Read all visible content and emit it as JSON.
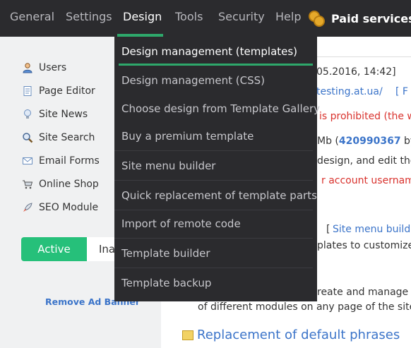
{
  "topnav": {
    "items": [
      "General",
      "Settings",
      "Design",
      "Tools",
      "Security",
      "Help"
    ],
    "active": "Design",
    "paid_label": "Paid services"
  },
  "sidebar": {
    "items": [
      {
        "label": "Users",
        "icon": "user-icon"
      },
      {
        "label": "Page Editor",
        "icon": "page-icon"
      },
      {
        "label": "Site News",
        "icon": "bulb-icon"
      },
      {
        "label": "Site Search",
        "icon": "search-icon"
      },
      {
        "label": "Email Forms",
        "icon": "mail-icon"
      },
      {
        "label": "Online Shop",
        "icon": "cart-icon"
      },
      {
        "label": "SEO Module",
        "icon": "rocket-icon"
      }
    ],
    "toggle_active": "Active",
    "toggle_inactive": "Ina",
    "remove_ad": "Remove Ad Banner"
  },
  "main": {
    "date_fragment": "05.2016, 14:42]",
    "url_fragment": "testing.at.ua/",
    "bracket_fragment": "[ F",
    "prohibited_fragment": "is prohibited (the w",
    "mb_prefix": "Mb (",
    "mb_number": "420990367",
    "mb_suffix": " by",
    "design_fragment": "design, and edit the",
    "username_fragment": "r account username",
    "menu_builder_bracket": "[",
    "menu_builder_link": "Site menu builde",
    "templates_fragment": "plates to customize",
    "create_fragment": "reate and manage in",
    "modules_fragment": "of different modules on any page of the site.",
    "replacement_link": "Replacement of default phrases"
  },
  "dropdown": {
    "items": [
      "Design management (templates)",
      "Design management (CSS)",
      "Choose design from Template Gallery",
      "Buy a premium template",
      "Site menu builder",
      "Quick replacement of template parts",
      "Import of remote code",
      "Template builder",
      "Template backup"
    ]
  },
  "colors": {
    "nav_bg": "#2b2b2e",
    "accent_green": "#2ea86b",
    "link_blue": "#3b74c9",
    "warning_red": "#d9322d"
  }
}
